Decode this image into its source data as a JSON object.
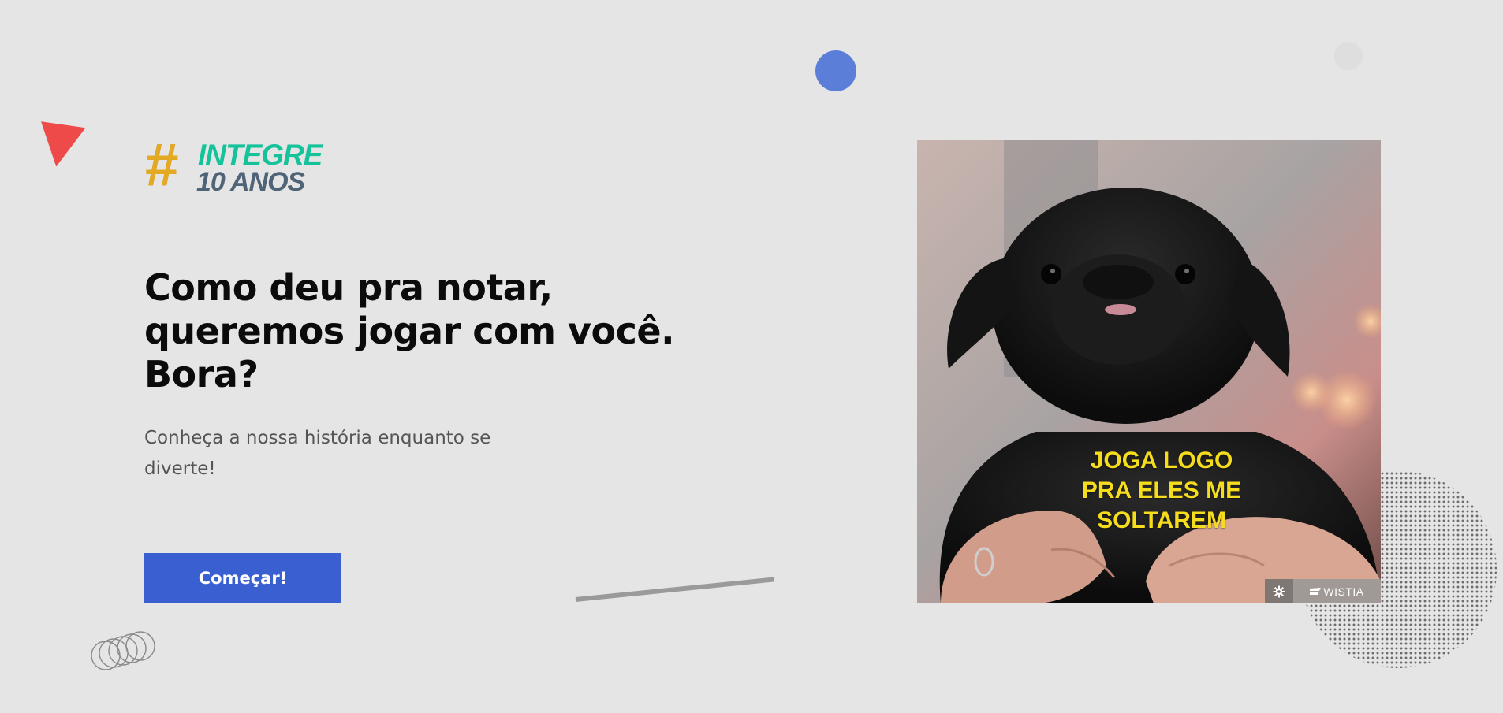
{
  "logo": {
    "hash": "#",
    "line1": "INTEGRE",
    "line2": "10 ANOS"
  },
  "headline": {
    "line1": "Como deu pra notar,",
    "line2": "queremos jogar com você.",
    "line3": "Bora?"
  },
  "subtext": "Conheça a nossa história enquanto se diverte!",
  "start_button": {
    "label": "Começar!"
  },
  "video": {
    "caption": {
      "line1": "JOGA LOGO",
      "line2": "PRA ELES ME",
      "line3": "SOLTAREM"
    },
    "controls": {
      "settings_icon": "gear-icon",
      "brand": "WISTIA"
    }
  },
  "colors": {
    "background": "#e5e5e5",
    "button": "#3a5fd0",
    "caption": "#f5dc1c",
    "logo_teal": "#14c39a",
    "logo_gold": "#e3a922",
    "logo_slate": "#4f6477",
    "triangle": "#ef4a4a",
    "circle": "#5b7fd8"
  }
}
